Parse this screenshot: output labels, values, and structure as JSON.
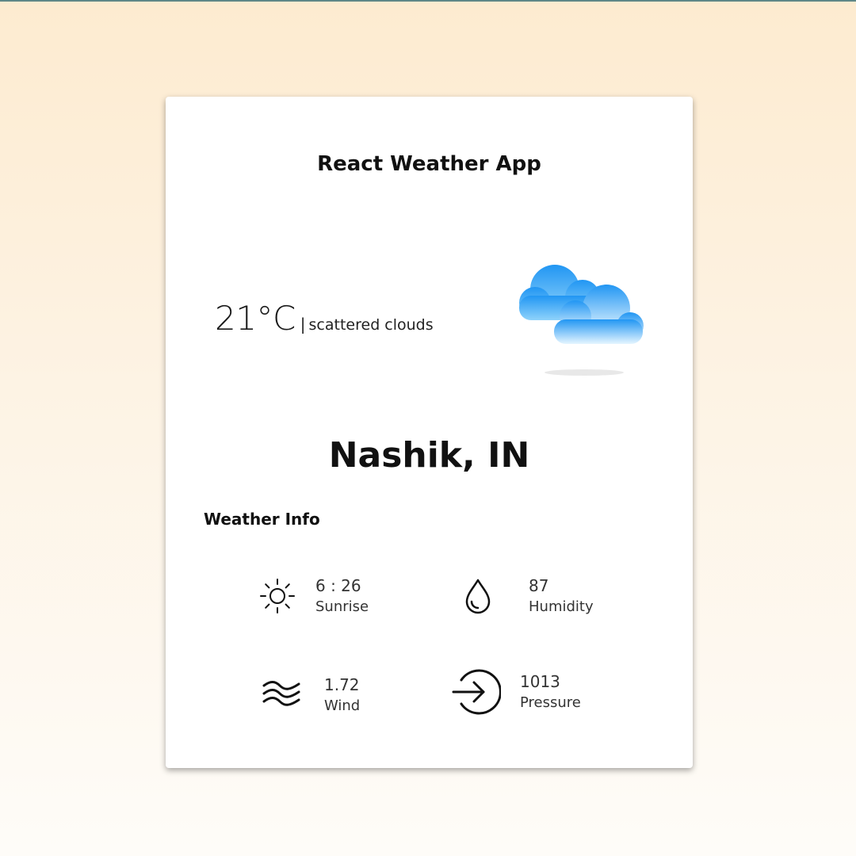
{
  "app": {
    "title": "React Weather App"
  },
  "current": {
    "temperature": "21°C",
    "separator": "|",
    "condition": "scattered clouds",
    "icon": "scattered-clouds-icon"
  },
  "location": {
    "city": "Nashik, IN"
  },
  "weather_info": {
    "heading": "Weather Info",
    "items": [
      {
        "icon": "sun-icon",
        "value": "6 : 26",
        "label": "Sunrise"
      },
      {
        "icon": "droplet-icon",
        "value": "87",
        "label": "Humidity"
      },
      {
        "icon": "wind-icon",
        "value": "1.72",
        "label": "Wind"
      },
      {
        "icon": "pressure-icon",
        "value": "1013",
        "label": "Pressure"
      }
    ]
  },
  "colors": {
    "cloud_light": "#5fbff7",
    "cloud_dark": "#2196f3",
    "background_top": "#fdebd0",
    "card": "#ffffff"
  }
}
